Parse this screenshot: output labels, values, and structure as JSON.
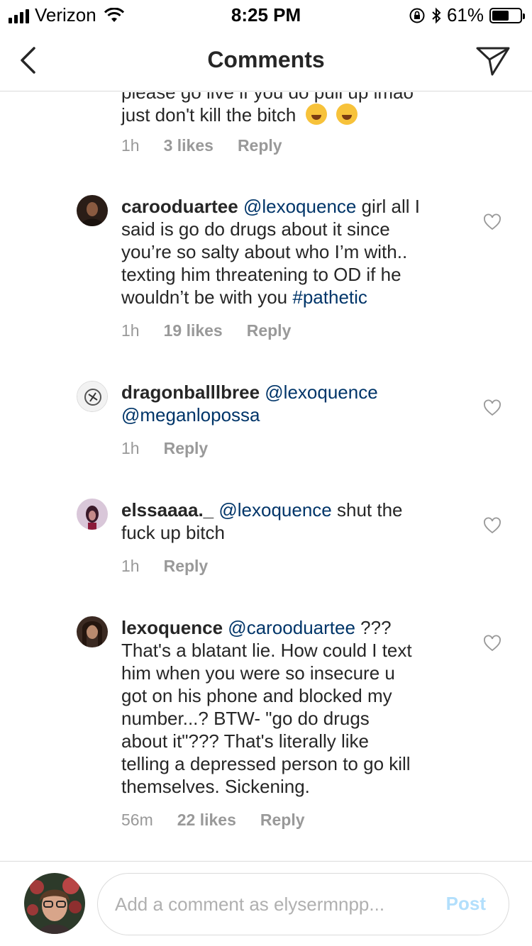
{
  "status_bar": {
    "carrier": "Verizon",
    "time": "8:25 PM",
    "battery_percent": "61%",
    "battery_level": 0.61,
    "icons": [
      "signal-icon",
      "wifi-icon",
      "orientation-lock-icon",
      "bluetooth-icon",
      "battery-icon"
    ]
  },
  "nav": {
    "title": "Comments",
    "back_icon": "chevron-left-icon",
    "send_icon": "paper-plane-icon"
  },
  "comments": [
    {
      "partial_text_top": "please go live if you do pull up lmao",
      "text": "just don't kill the bitch",
      "emojis": [
        "loudly-crying-face",
        "face-with-tears-of-joy"
      ],
      "time": "1h",
      "likes": "3 likes",
      "reply": "Reply"
    },
    {
      "username": "carooduartee",
      "mention": "@lexoquence",
      "text_lines": [
        "girl all I",
        "said is go do drugs about it since",
        "you’re so salty about who I’m with..",
        "texting him threatening to OD if he",
        "wouldn’t be with you "
      ],
      "hashtag": "#pathetic",
      "time": "1h",
      "likes": "19 likes",
      "reply": "Reply"
    },
    {
      "username": "dragonballlbree",
      "mention": "@lexoquence",
      "mention2": "@meganlopossa",
      "time": "1h",
      "reply": "Reply"
    },
    {
      "username": "elssaaaa._",
      "mention": "@lexoquence",
      "text_lines": [
        "shut the",
        "fuck up bitch"
      ],
      "time": "1h",
      "reply": "Reply"
    },
    {
      "username": "lexoquence",
      "mention": "@carooduartee",
      "text_lines": [
        "???",
        "That's a blatant lie. How could I text",
        "him when you were so insecure u",
        "got on his phone and blocked my",
        "number...? BTW- \"go do drugs",
        "about it\"??? That's literally like",
        "telling a depressed person to go kill",
        "themselves. Sickening."
      ],
      "time": "56m",
      "likes": "22 likes",
      "reply": "Reply"
    }
  ],
  "composer": {
    "placeholder": "Add a comment as elysermnpp...",
    "post_label": "Post"
  },
  "colors": {
    "text": "#262626",
    "mention": "#003569",
    "meta": "#999999",
    "post_disabled": "#b2dffc",
    "border": "#dbdbdb"
  }
}
